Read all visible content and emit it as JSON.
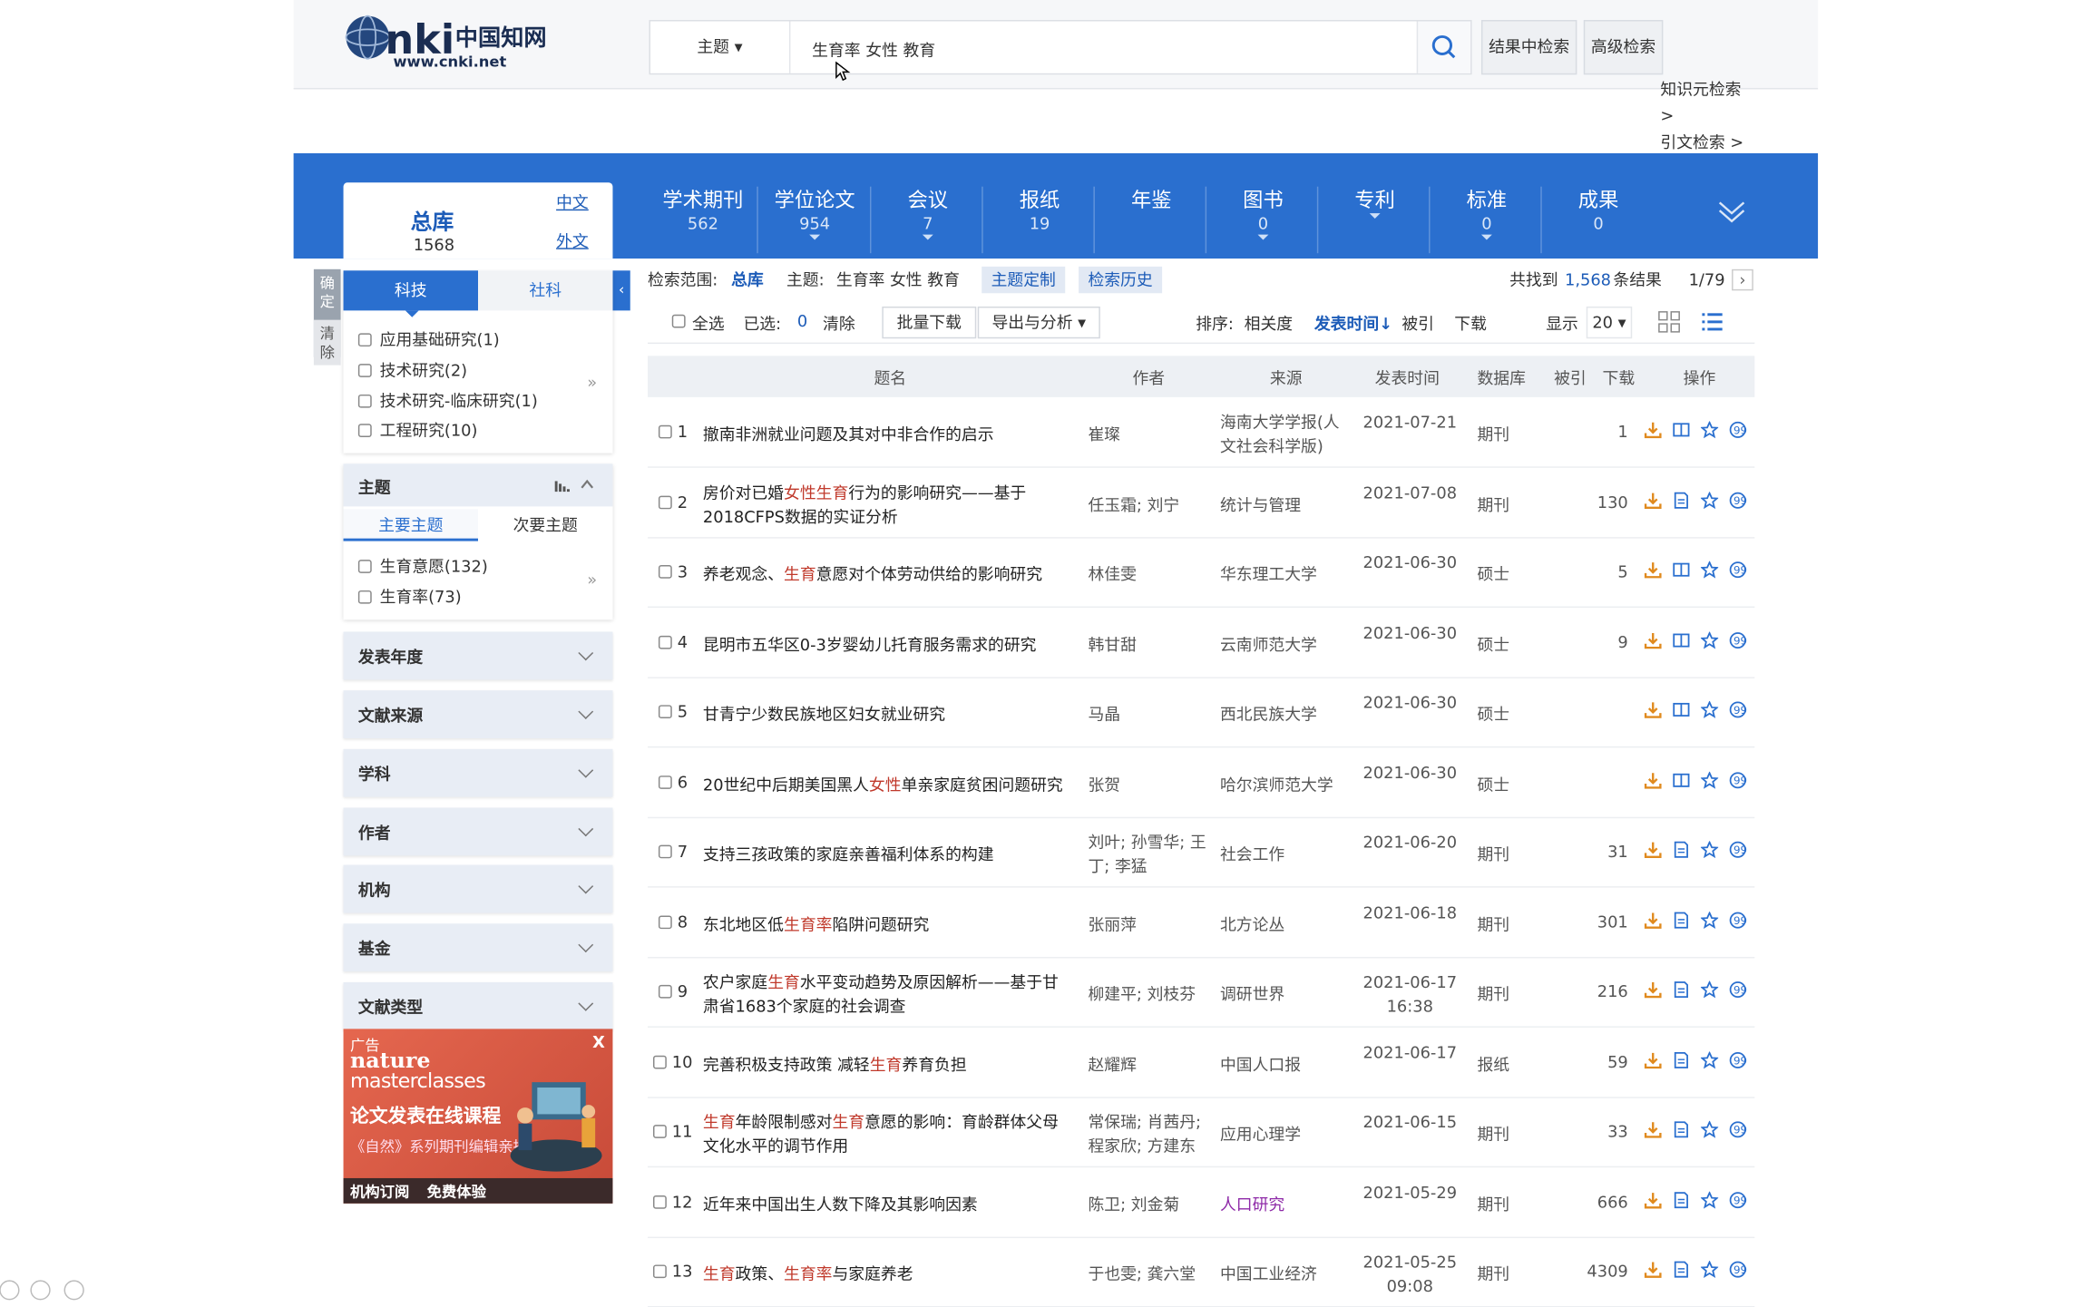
{
  "header": {
    "logo_text": "CNKI中国知网 www.cnki.net",
    "search_type": "主题 ▾",
    "search_value": "生育率 女性 教育",
    "btn_in_results": "结果中检索",
    "btn_advanced": "高级检索",
    "link_knowledge": "知识元检索 >",
    "link_citation": "引文检索 >"
  },
  "databases": {
    "all": {
      "label": "总库",
      "count": "1568",
      "lang_cn": "中文",
      "lang_foreign": "外文"
    },
    "tabs": [
      {
        "label": "学术期刊",
        "count": "562",
        "arrow": false
      },
      {
        "label": "学位论文",
        "count": "954",
        "arrow": true
      },
      {
        "label": "会议",
        "count": "7",
        "arrow": true
      },
      {
        "label": "报纸",
        "count": "19",
        "arrow": false
      },
      {
        "label": "年鉴",
        "count": "",
        "arrow": false
      },
      {
        "label": "图书",
        "count": "0",
        "arrow": true
      },
      {
        "label": "专利",
        "count": "",
        "arrow": true
      },
      {
        "label": "标准",
        "count": "0",
        "arrow": true
      },
      {
        "label": "成果",
        "count": "0",
        "arrow": false
      }
    ]
  },
  "sidebar": {
    "confirm": "确定",
    "clear": "清除",
    "tab_keji": "科技",
    "tab_sheke": "社科",
    "research_items": [
      "应用基础研究(1)",
      "技术研究(2)",
      "技术研究-临床研究(1)",
      "工程研究(10)"
    ],
    "topic": {
      "title": "主题",
      "tab_main": "主要主题",
      "tab_sub": "次要主题",
      "items": [
        "生育意愿(132)",
        "生育率(73)"
      ]
    },
    "facets": [
      "发表年度",
      "文献来源",
      "学科",
      "作者",
      "机构",
      "基金",
      "文献类型"
    ],
    "ad": {
      "tag": "广告",
      "brand1": "nature",
      "brand2": "masterclasses",
      "headline": "论文发表在线课程",
      "sub": "《自然》系列期刊编辑亲授",
      "footer1": "机构订阅",
      "footer2": "免费体验",
      "close": "X"
    }
  },
  "scope": {
    "label": "检索范围:",
    "range": "总库",
    "topic_label": "主题:",
    "topic_value": "生育率 女性 教育",
    "btn_custom": "主题定制",
    "btn_history": "检索历史",
    "found_prefix": "共找到",
    "found_count": "1,568",
    "found_suffix": "条结果",
    "page": "1/79",
    "next": "›"
  },
  "toolbar": {
    "select_all": "全选",
    "selected_label": "已选:",
    "selected_count": "0",
    "clear": "清除",
    "batch_download": "批量下载",
    "export": "导出与分析 ▾",
    "sort_label": "排序:",
    "sort_relevance": "相关度",
    "sort_date": "发表时间↓",
    "sort_cited": "被引",
    "sort_download": "下载",
    "show_label": "显示",
    "show_value": "20 ▾"
  },
  "table": {
    "headers": [
      "题名",
      "作者",
      "来源",
      "发表时间",
      "数据库",
      "被引",
      "下载",
      "操作"
    ],
    "rows": [
      {
        "n": "1",
        "title": [
          [
            "撤南非洲就业问题及其对中非合作的启示",
            ""
          ]
        ],
        "author": "崔璨",
        "source": "海南大学学报(人文社会科学版)",
        "date": "2021-07-21",
        "db": "期刊",
        "dl": "1",
        "read": "book"
      },
      {
        "n": "2",
        "title": [
          [
            "房价对已婚",
            ""
          ],
          [
            "女性生育",
            "h"
          ],
          [
            "行为的影响研究——基于2018CFPS数据的实证分析",
            ""
          ]
        ],
        "author": "任玉霜; 刘宁",
        "source": "统计与管理",
        "date": "2021-07-08",
        "db": "期刊",
        "dl": "130",
        "read": "doc"
      },
      {
        "n": "3",
        "title": [
          [
            "养老观念、",
            ""
          ],
          [
            "生育",
            "h"
          ],
          [
            "意愿对个体劳动供给的影响研究",
            ""
          ]
        ],
        "author": "林佳雯",
        "source": "华东理工大学",
        "date": "2021-06-30",
        "db": "硕士",
        "dl": "5",
        "read": "book"
      },
      {
        "n": "4",
        "title": [
          [
            "昆明市五华区0-3岁婴幼儿托育服务需求的研究",
            ""
          ]
        ],
        "author": "韩甘甜",
        "source": "云南师范大学",
        "date": "2021-06-30",
        "db": "硕士",
        "dl": "9",
        "read": "book"
      },
      {
        "n": "5",
        "title": [
          [
            "甘青宁少数民族地区妇女就业研究",
            ""
          ]
        ],
        "author": "马晶",
        "source": "西北民族大学",
        "date": "2021-06-30",
        "db": "硕士",
        "dl": "",
        "read": "book"
      },
      {
        "n": "6",
        "title": [
          [
            "20世纪中后期美国黑人",
            ""
          ],
          [
            "女性",
            "h"
          ],
          [
            "单亲家庭贫困问题研究",
            ""
          ]
        ],
        "author": "张贺",
        "source": "哈尔滨师范大学",
        "date": "2021-06-30",
        "db": "硕士",
        "dl": "",
        "read": "book"
      },
      {
        "n": "7",
        "title": [
          [
            "支持三孩政策的家庭亲善福利体系的构建",
            ""
          ]
        ],
        "author": "刘叶; 孙雪华; 王丁; 李猛",
        "source": "社会工作",
        "date": "2021-06-20",
        "db": "期刊",
        "dl": "31",
        "read": "doc"
      },
      {
        "n": "8",
        "title": [
          [
            "东北地区低",
            ""
          ],
          [
            "生育率",
            "h"
          ],
          [
            "陷阱问题研究",
            ""
          ]
        ],
        "author": "张丽萍",
        "source": "北方论丛",
        "date": "2021-06-18",
        "db": "期刊",
        "dl": "301",
        "read": "doc"
      },
      {
        "n": "9",
        "title": [
          [
            "农户家庭",
            ""
          ],
          [
            "生育",
            "h"
          ],
          [
            "水平变动趋势及原因解析——基于甘肃省1683个家庭的社会调查",
            ""
          ]
        ],
        "author": "柳建平; 刘枝芬",
        "source": "调研世界",
        "date": "2021-06-17 16:38",
        "db": "期刊",
        "dl": "216",
        "read": "doc"
      },
      {
        "n": "10",
        "title": [
          [
            "完善积极支持政策 减轻",
            ""
          ],
          [
            "生育",
            "h"
          ],
          [
            "养育负担",
            ""
          ]
        ],
        "author": "赵耀辉",
        "source": "中国人口报",
        "date": "2021-06-17",
        "db": "报纸",
        "dl": "59",
        "read": "doc"
      },
      {
        "n": "11",
        "title": [
          [
            "生育",
            "h"
          ],
          [
            "年龄限制感对",
            ""
          ],
          [
            "生育",
            "h"
          ],
          [
            "意愿的影响：育龄群体父母文化水平的调节作用",
            ""
          ]
        ],
        "author": "常保瑞; 肖茜丹; 程家欣; 方建东",
        "source": "应用心理学",
        "date": "2021-06-15",
        "db": "期刊",
        "dl": "33",
        "read": "doc"
      },
      {
        "n": "12",
        "title": [
          [
            "近年来中国出生人数下降及其影响因素",
            ""
          ]
        ],
        "author": "陈卫; 刘金菊",
        "source": "人口研究",
        "date": "2021-05-29",
        "db": "期刊",
        "dl": "666",
        "read": "doc",
        "srcPurple": true
      },
      {
        "n": "13",
        "title": [
          [
            "生育",
            "h"
          ],
          [
            "政策、",
            ""
          ],
          [
            "生育率",
            "h"
          ],
          [
            "与家庭养老",
            ""
          ]
        ],
        "author": "于也雯; 龚六堂",
        "source": "中国工业经济",
        "date": "2021-05-25 09:08",
        "db": "期刊",
        "dl": "4309",
        "read": "doc"
      }
    ]
  },
  "colors": {
    "brand_blue": "#2a6fcf",
    "highlight_red": "#c0392b",
    "download_orange": "#e08a1e",
    "icon_blue": "#2a6fcf"
  }
}
